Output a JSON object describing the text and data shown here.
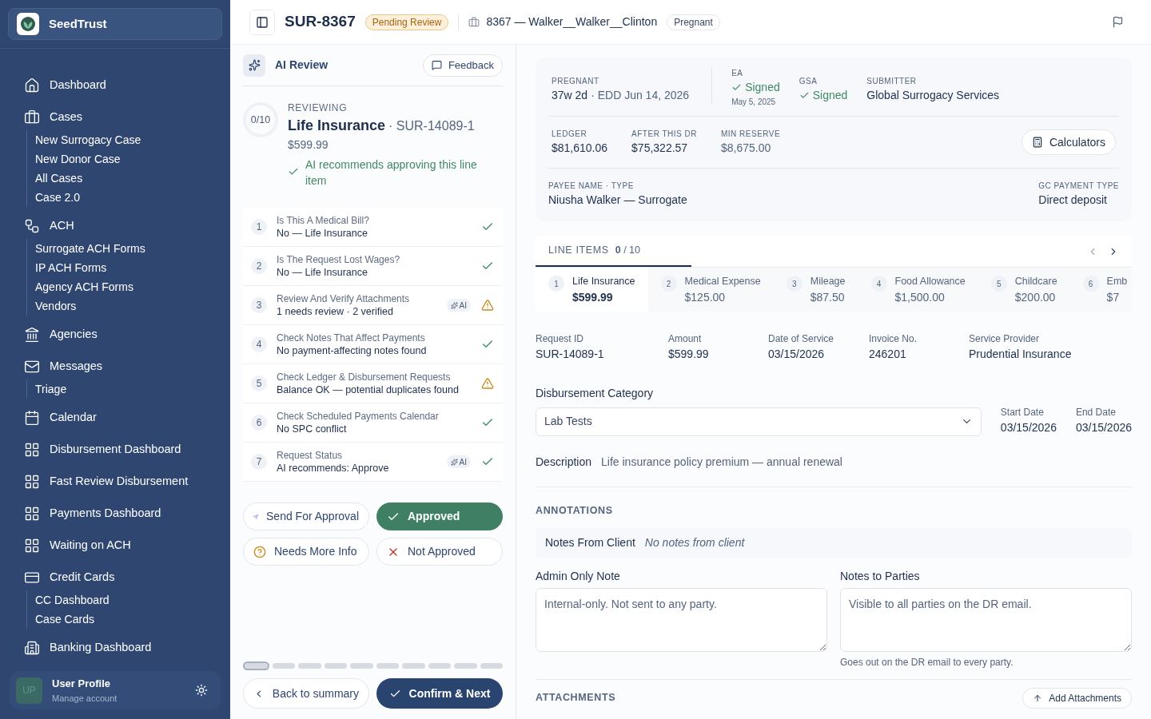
{
  "sidebar": {
    "brand": "SeedTrust",
    "nav": [
      {
        "label": "Dashboard"
      },
      {
        "label": "Cases",
        "children": [
          {
            "label": "New Surrogacy Case"
          },
          {
            "label": "New Donor Case"
          },
          {
            "label": "All Cases"
          },
          {
            "label": "Case 2.0"
          }
        ]
      },
      {
        "label": "ACH",
        "children": [
          {
            "label": "Surrogate ACH Forms"
          },
          {
            "label": "IP ACH Forms"
          },
          {
            "label": "Agency ACH Forms"
          },
          {
            "label": "Vendors"
          }
        ]
      },
      {
        "label": "Agencies"
      },
      {
        "label": "Messages",
        "children": [
          {
            "label": "Triage"
          }
        ]
      },
      {
        "label": "Calendar"
      },
      {
        "label": "Disbursement Dashboard"
      },
      {
        "label": "Fast Review Disbursement"
      },
      {
        "label": "Payments Dashboard"
      },
      {
        "label": "Waiting on ACH"
      },
      {
        "label": "Credit Cards",
        "children": [
          {
            "label": "CC Dashboard"
          },
          {
            "label": "Case Cards"
          }
        ]
      },
      {
        "label": "Banking Dashboard"
      }
    ],
    "user": {
      "initials": "UP",
      "name": "User Profile",
      "subtitle": "Manage account"
    }
  },
  "header": {
    "case_id": "SUR-8367",
    "status": "Pending Review",
    "case_name": "8367 — Walker__Walker__Clinton",
    "tag": "Pregnant"
  },
  "review": {
    "title": "AI Review",
    "feedback": "Feedback",
    "progress": "0/10",
    "eyebrow": "REVIEWING",
    "item_title": "Life Insurance",
    "item_id": "· SUR-14089-1",
    "amount": "$599.99",
    "recommendation": "AI recommends approving this line item",
    "checks": [
      {
        "number": "1",
        "title": "Is This A Medical Bill?",
        "detail": "No — Life Insurance",
        "warning": false
      },
      {
        "number": "2",
        "title": "Is The Request Lost Wages?",
        "detail": "No — Life Insurance",
        "warning": false
      },
      {
        "number": "3",
        "title": "Review And Verify Attachments",
        "detail": "1 needs review · 2 verified",
        "badge": "AI",
        "warning": true
      },
      {
        "number": "4",
        "title": "Check Notes That Affect Payments",
        "detail": "No payment-affecting notes found",
        "warning": false
      },
      {
        "number": "5",
        "title": "Check Ledger & Disbursement Requests",
        "detail": "Balance OK — potential duplicates found",
        "warning": true
      },
      {
        "number": "6",
        "title": "Check Scheduled Payments Calendar",
        "detail": "No SPC conflict",
        "warning": false
      },
      {
        "number": "7",
        "title": "Request Status",
        "detail": "AI recommends: Approve",
        "badge": "AI",
        "warning": false
      }
    ],
    "decisions": [
      {
        "kind": "send",
        "label": "Send For Approval",
        "selected": false
      },
      {
        "kind": "approve",
        "label": "Approved",
        "selected": true
      },
      {
        "kind": "info",
        "label": "Needs More Info",
        "selected": false
      },
      {
        "kind": "reject",
        "label": "Not Approved",
        "selected": false
      }
    ],
    "steps": [
      {
        "selected": true
      },
      {
        "selected": false
      },
      {
        "selected": false
      },
      {
        "selected": false
      },
      {
        "selected": false
      },
      {
        "selected": false
      },
      {
        "selected": false
      },
      {
        "selected": false
      },
      {
        "selected": false
      },
      {
        "selected": false
      }
    ],
    "back": "Back to summary",
    "confirm": "Confirm & Next"
  },
  "summary": {
    "pregnant": {
      "label": "PREGNANT",
      "weeks": "37w 2d",
      "edd": "· EDD Jun 14, 2026"
    },
    "signatures": [
      {
        "label": "EA",
        "status": "Signed",
        "signed": true,
        "date": "May 5, 2025"
      },
      {
        "label": "GSA",
        "status": "Signed",
        "signed": true
      }
    ],
    "submitter": {
      "label": "SUBMITTER",
      "value": "Global Surrogacy Services"
    },
    "balances": [
      {
        "label": "LEDGER",
        "value": "$81,610.06"
      },
      {
        "label": "AFTER THIS DR",
        "value": "$75,322.57"
      },
      {
        "label": "MIN RESERVE",
        "value": "$8,675.00"
      }
    ],
    "calculators": "Calculators",
    "payee": {
      "label": "PAYEE NAME · TYPE",
      "value": "Niusha Walker — Surrogate"
    },
    "payment_type": {
      "label": "GC PAYMENT TYPE",
      "value": "Direct deposit"
    }
  },
  "line_items": {
    "title": "LINE ITEMS",
    "count": "**0** / 10",
    "items": [
      {
        "number": "1",
        "name": "Life Insurance",
        "amount": "$599.99",
        "selected": true
      },
      {
        "number": "2",
        "name": "Medical Expense",
        "amount": "$125.00",
        "selected": false
      },
      {
        "number": "3",
        "name": "Mileage",
        "amount": "$87.50",
        "selected": false
      },
      {
        "number": "4",
        "name": "Food Allowance",
        "amount": "$1,500.00",
        "selected": false
      },
      {
        "number": "5",
        "name": "Childcare",
        "amount": "$200.00",
        "selected": false
      },
      {
        "number": "6",
        "name": "Emb",
        "amount": "$7",
        "selected": false
      }
    ]
  },
  "details": [
    {
      "label": "Request ID",
      "value": "SUR-14089-1"
    },
    {
      "label": "Amount",
      "value": "$599.99"
    },
    {
      "label": "Date of Service",
      "value": "03/15/2026"
    },
    {
      "label": "Invoice No.",
      "value": "246201"
    },
    {
      "label": "Service Provider",
      "value": "Prudential Insurance"
    }
  ],
  "category": {
    "label": "Disbursement Category",
    "value": "Lab Tests"
  },
  "dates": [
    {
      "label": "Start Date",
      "value": "03/15/2026"
    },
    {
      "label": "End Date",
      "value": "03/15/2026"
    }
  ],
  "description": {
    "label": "Description",
    "value": "Life insurance policy premium — annual renewal"
  },
  "annotations": {
    "title": "ANNOTATIONS",
    "client_label": "Notes From Client",
    "client_value": "No notes from client",
    "admin": {
      "label": "Admin Only Note",
      "placeholder": "Internal-only. Not sent to any party."
    },
    "parties": {
      "label": "Notes to Parties",
      "placeholder": "Visible to all parties on the DR email.",
      "hint": "Goes out on the DR email to every party."
    }
  },
  "attachments": {
    "title": "ATTACHMENTS",
    "button": "Add Attachments"
  }
}
